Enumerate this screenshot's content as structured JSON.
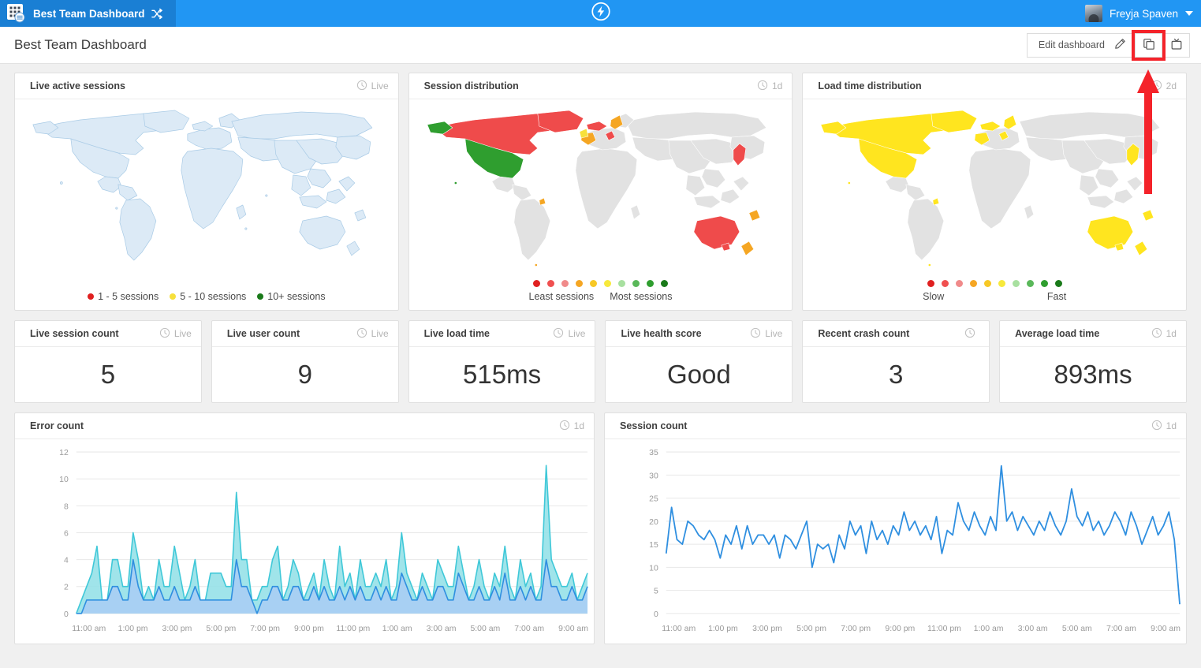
{
  "topbar": {
    "app_tab_label": "Best Team Dashboard",
    "grid_icon": "grid-apps-icon",
    "shuffle_icon": "shuffle-icon",
    "center_logo_icon": "lightning-bolt-circle-icon",
    "user_name": "Freyja Spaven",
    "avatar_icon": "user-avatar",
    "caret_icon": "chevron-down-icon",
    "accent_color": "#2196f3",
    "tab_color": "#1a7fd4"
  },
  "header": {
    "page_title": "Best Team Dashboard",
    "edit_label": "Edit dashboard",
    "pencil_icon": "pencil-icon",
    "duplicate_icon": "copy-duplicate-icon",
    "tv_icon": "tv-presentation-icon",
    "highlight_color": "#f4232a",
    "annotation_arrow": "red-up-arrow-annotation"
  },
  "cards": {
    "live_active_sessions": {
      "title": "Live active sessions",
      "time": "Live",
      "clock_icon": "clock-icon",
      "legend": [
        {
          "label": "1 - 5 sessions",
          "color": "#e02020"
        },
        {
          "label": "5 - 10 sessions",
          "color": "#f7e03c"
        },
        {
          "label": "10+ sessions",
          "color": "#1a7a1a"
        }
      ]
    },
    "session_distribution": {
      "title": "Session distribution",
      "time": "1d",
      "clock_icon": "clock-icon",
      "scale_low_label": "Least sessions",
      "scale_high_label": "Most sessions",
      "scale_colors": [
        "#e02020",
        "#f05050",
        "#f08a8a",
        "#f5a623",
        "#f7c825",
        "#f7e93c",
        "#a8e0a0",
        "#5ab85a",
        "#2f9e2f",
        "#1a7a1a"
      ]
    },
    "load_time_distribution": {
      "title": "Load time distribution",
      "time": "2d",
      "clock_icon": "clock-icon",
      "scale_low_label": "Slow",
      "scale_high_label": "Fast",
      "scale_colors": [
        "#e02020",
        "#f05050",
        "#f08a8a",
        "#f5a623",
        "#f7c825",
        "#f7e93c",
        "#a8e0a0",
        "#5ab85a",
        "#2f9e2f",
        "#1a7a1a"
      ]
    }
  },
  "stats": [
    {
      "title": "Live session count",
      "time": "Live",
      "clock_icon": "clock-icon",
      "value": "5"
    },
    {
      "title": "Live user count",
      "time": "Live",
      "clock_icon": "clock-icon",
      "value": "9"
    },
    {
      "title": "Live load time",
      "time": "Live",
      "clock_icon": "clock-icon",
      "value": "515ms"
    },
    {
      "title": "Live health score",
      "time": "Live",
      "clock_icon": "clock-icon",
      "value": "Good"
    },
    {
      "title": "Recent crash count",
      "time": "",
      "clock_icon": "clock-icon",
      "value": "3"
    },
    {
      "title": "Average load time",
      "time": "1d",
      "clock_icon": "clock-icon",
      "value": "893ms"
    }
  ],
  "chart_data": [
    {
      "type": "area",
      "title": "Error count",
      "time": "1d",
      "clock_icon": "clock-icon",
      "xlabel": "",
      "ylabel": "",
      "ylim": [
        0,
        12
      ],
      "yticks": [
        0,
        2,
        4,
        6,
        8,
        10,
        12
      ],
      "grid": true,
      "legend_position": "none",
      "x_tick_labels": [
        "11:00 am",
        "1:00 pm",
        "3:00 pm",
        "5:00 pm",
        "7:00 pm",
        "9:00 pm",
        "11:00 pm",
        "1:00 am",
        "3:00 am",
        "5:00 am",
        "7:00 am",
        "9:00 am"
      ],
      "series": [
        {
          "name": "errors-light",
          "color": "#3fc8d8",
          "fill": "#8fdfe6",
          "values": [
            0,
            1,
            2,
            3,
            5,
            1,
            1,
            4,
            4,
            2,
            2,
            6,
            4,
            1,
            2,
            1,
            4,
            2,
            2,
            5,
            3,
            1,
            2,
            4,
            1,
            1,
            3,
            3,
            3,
            2,
            2,
            9,
            4,
            4,
            1,
            1,
            2,
            2,
            4,
            5,
            1,
            2,
            4,
            3,
            1,
            2,
            3,
            1,
            4,
            2,
            1,
            5,
            2,
            3,
            1,
            4,
            2,
            2,
            3,
            2,
            4,
            1,
            2,
            6,
            3,
            2,
            1,
            3,
            2,
            1,
            4,
            3,
            2,
            2,
            5,
            3,
            1,
            2,
            4,
            2,
            1,
            3,
            2,
            5,
            2,
            1,
            4,
            2,
            3,
            1,
            2,
            11,
            4,
            3,
            2,
            2,
            3,
            1,
            2,
            3
          ]
        },
        {
          "name": "errors-dark",
          "color": "#2f8fe0",
          "fill": "#a9cdf5",
          "values": [
            0,
            0,
            1,
            1,
            1,
            1,
            1,
            2,
            2,
            1,
            1,
            4,
            2,
            1,
            1,
            1,
            2,
            1,
            1,
            2,
            1,
            1,
            1,
            2,
            1,
            1,
            1,
            1,
            1,
            1,
            1,
            4,
            2,
            2,
            1,
            0,
            1,
            1,
            2,
            2,
            1,
            1,
            2,
            2,
            1,
            1,
            2,
            1,
            2,
            1,
            1,
            2,
            1,
            2,
            1,
            2,
            1,
            1,
            2,
            1,
            2,
            1,
            1,
            3,
            2,
            1,
            1,
            2,
            1,
            1,
            2,
            2,
            1,
            1,
            3,
            2,
            1,
            1,
            2,
            1,
            1,
            2,
            1,
            3,
            1,
            1,
            2,
            1,
            2,
            1,
            1,
            4,
            2,
            2,
            1,
            1,
            2,
            1,
            1,
            2
          ]
        }
      ]
    },
    {
      "type": "line",
      "title": "Session count",
      "time": "1d",
      "clock_icon": "clock-icon",
      "xlabel": "",
      "ylabel": "",
      "ylim": [
        0,
        35
      ],
      "yticks": [
        0,
        5,
        10,
        15,
        20,
        25,
        30,
        35
      ],
      "grid": true,
      "legend_position": "none",
      "x_tick_labels": [
        "11:00 am",
        "1:00 pm",
        "3:00 pm",
        "5:00 pm",
        "7:00 pm",
        "9:00 pm",
        "11:00 pm",
        "1:00 am",
        "3:00 am",
        "5:00 am",
        "7:00 am",
        "9:00 am"
      ],
      "series": [
        {
          "name": "sessions",
          "color": "#2f8fe0",
          "values": [
            13,
            23,
            16,
            15,
            20,
            19,
            17,
            16,
            18,
            16,
            12,
            17,
            15,
            19,
            14,
            19,
            15,
            17,
            17,
            15,
            17,
            12,
            17,
            16,
            14,
            17,
            20,
            10,
            15,
            14,
            15,
            11,
            17,
            14,
            20,
            17,
            19,
            13,
            20,
            16,
            18,
            15,
            19,
            17,
            22,
            18,
            20,
            17,
            19,
            16,
            21,
            13,
            18,
            17,
            24,
            20,
            18,
            22,
            19,
            17,
            21,
            18,
            32,
            20,
            22,
            18,
            21,
            19,
            17,
            20,
            18,
            22,
            19,
            17,
            20,
            27,
            21,
            19,
            22,
            18,
            20,
            17,
            19,
            22,
            20,
            17,
            22,
            19,
            15,
            18,
            21,
            17,
            19,
            22,
            16,
            2
          ]
        }
      ]
    }
  ]
}
